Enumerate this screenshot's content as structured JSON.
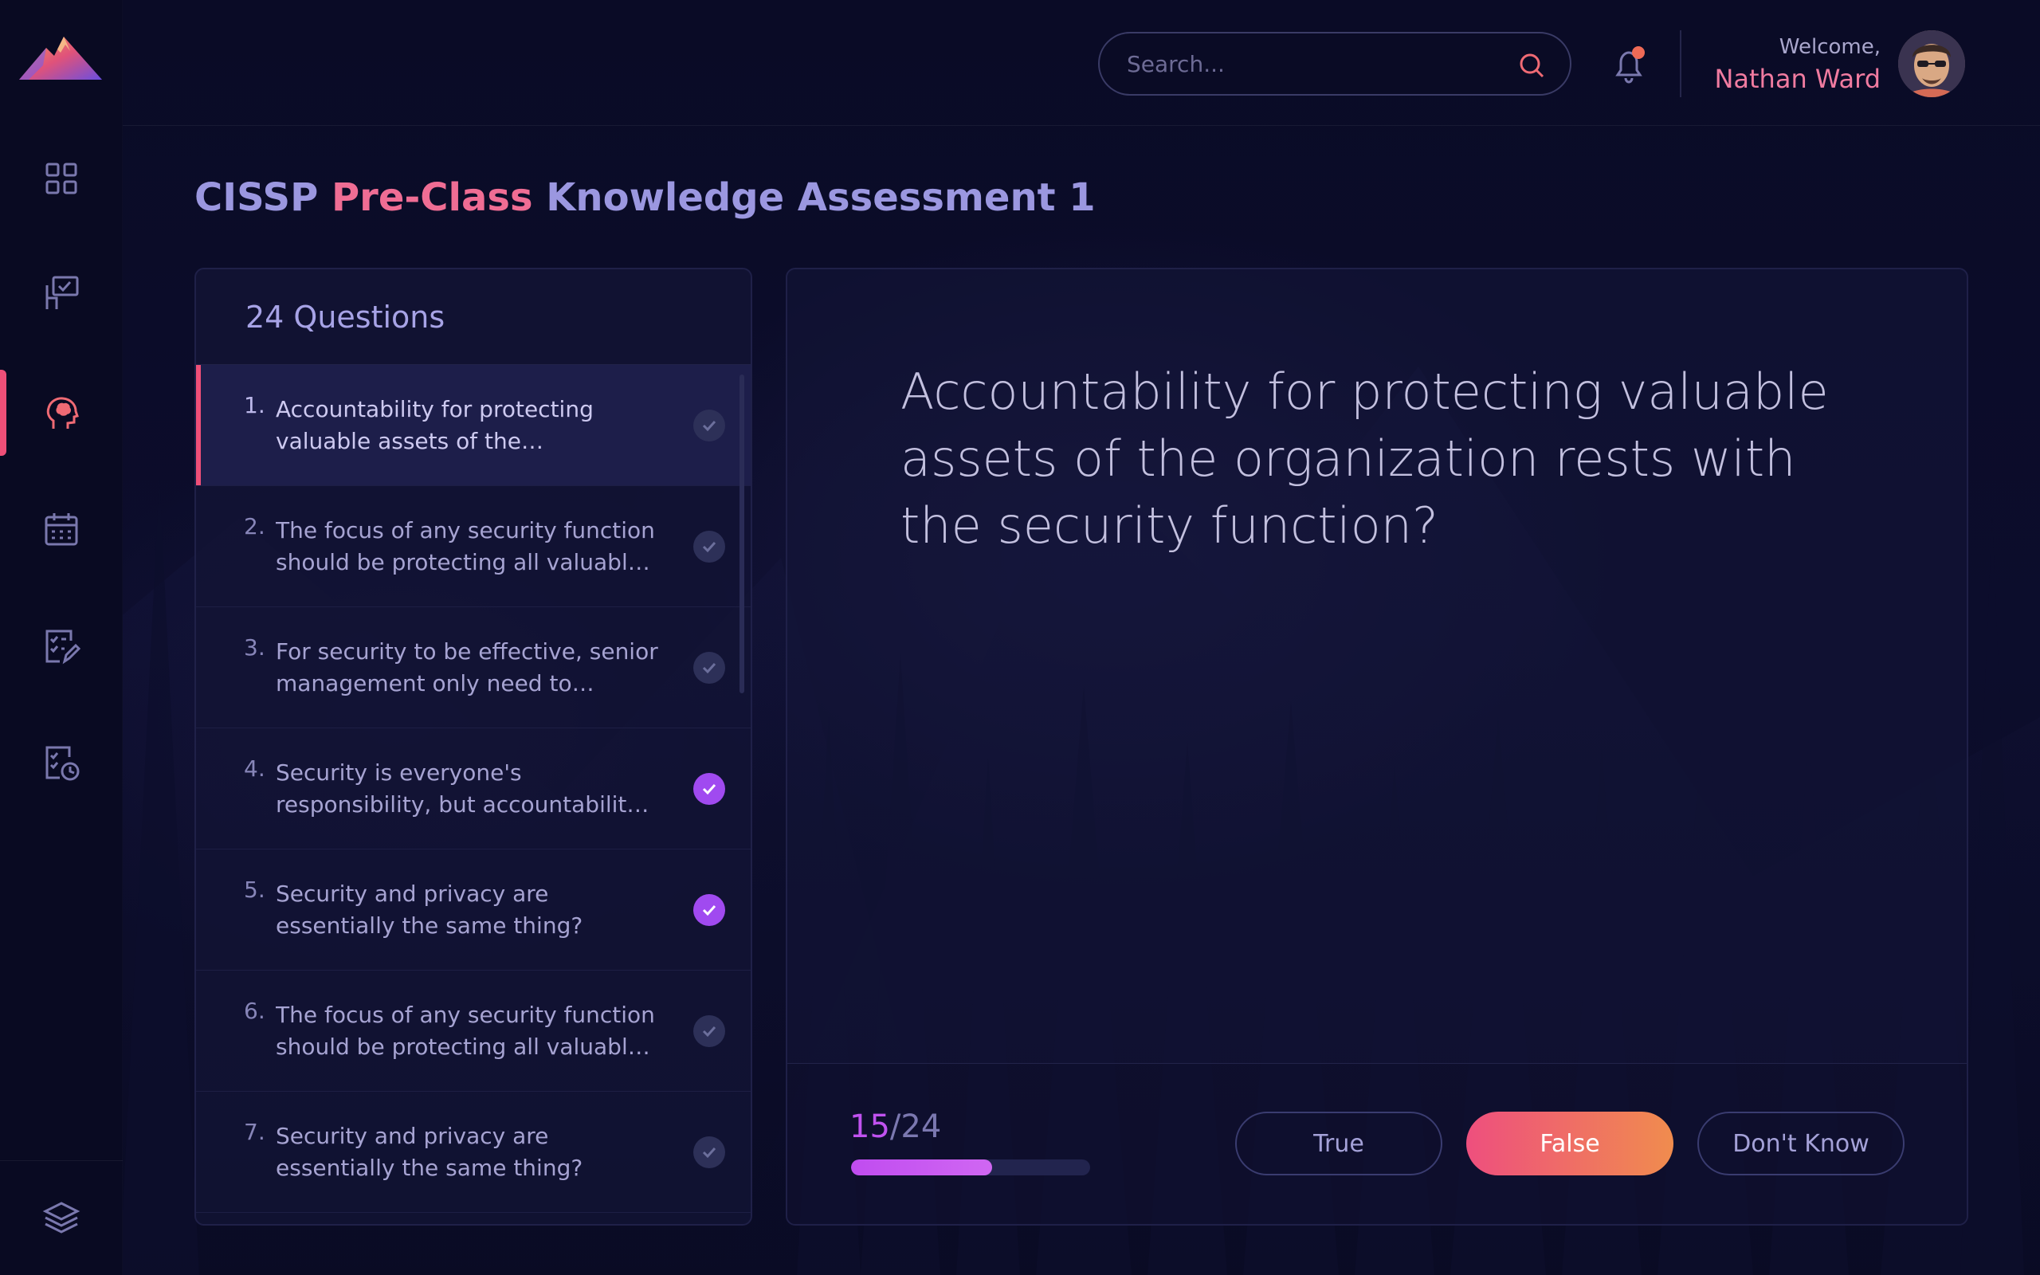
{
  "header": {
    "search_placeholder": "Search...",
    "welcome": "Welcome,",
    "username": "Nathan Ward"
  },
  "sidebar": {
    "items": [
      {
        "name": "dashboard",
        "icon": "grid-icon"
      },
      {
        "name": "courses",
        "icon": "presentation-check-icon"
      },
      {
        "name": "assessments",
        "icon": "brain-head-icon",
        "active": true
      },
      {
        "name": "calendar",
        "icon": "calendar-icon"
      },
      {
        "name": "tasks",
        "icon": "checklist-edit-icon"
      },
      {
        "name": "history",
        "icon": "checklist-clock-icon"
      }
    ],
    "bottom": {
      "name": "layers",
      "icon": "layers-icon"
    }
  },
  "page": {
    "title_part1": "CISSP ",
    "title_part2": "Pre-Class",
    "title_part3": " Knowledge Assessment 1"
  },
  "questions_panel": {
    "heading": "24 Questions",
    "items": [
      {
        "num": "1.",
        "text": "Accountability for protecting valuable assets of the organization",
        "done": false,
        "active": true
      },
      {
        "num": "2.",
        "text": "The focus of any security function should be protecting all valuable assets",
        "done": false,
        "active": false
      },
      {
        "num": "3.",
        "text": "For security to be effective, senior management only need to allocate",
        "done": false,
        "active": false
      },
      {
        "num": "4.",
        "text": "Security is everyone's responsibility, but accountability rests with senior management",
        "done": true,
        "active": false
      },
      {
        "num": "5.",
        "text": "Security and privacy are essentially the same thing?",
        "done": true,
        "active": false
      },
      {
        "num": "6.",
        "text": "The focus of any security function should be protecting all valuable assets",
        "done": false,
        "active": false
      },
      {
        "num": "7.",
        "text": "Security and privacy are essentially the same thing?",
        "done": false,
        "active": false
      }
    ]
  },
  "question_card": {
    "text": "Accountability for protecting valuable assets of the organization rests with the security function?",
    "progress_current": "15",
    "progress_sep": "/",
    "progress_total": "24",
    "progress_fraction": 0.59,
    "buttons": {
      "true": "True",
      "false": "False",
      "dont_know": "Don't Know"
    }
  },
  "colors": {
    "accent_pink": "#ef4f78",
    "accent_purple": "#a04af0",
    "background": "#0a0b24"
  }
}
